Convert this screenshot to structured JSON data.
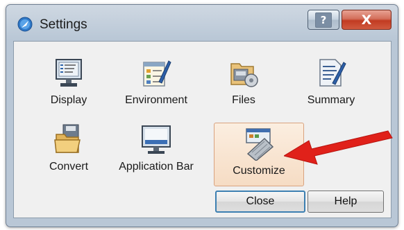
{
  "window": {
    "title": "Settings",
    "help_button_glyph": "?",
    "close_button_glyph": "X"
  },
  "tiles": [
    {
      "label": "Display",
      "icon": "display-icon"
    },
    {
      "label": "Environment",
      "icon": "environment-icon"
    },
    {
      "label": "Files",
      "icon": "files-icon"
    },
    {
      "label": "Summary",
      "icon": "summary-icon"
    },
    {
      "label": "Convert",
      "icon": "convert-icon"
    },
    {
      "label": "Application Bar",
      "icon": "application-bar-icon"
    },
    {
      "label": "Customize",
      "icon": "customize-icon",
      "selected": true
    }
  ],
  "buttons": {
    "close_label": "Close",
    "help_label": "Help"
  },
  "colors": {
    "selection_fill": "#f6dcc4",
    "annotation_arrow": "#e0211a",
    "close_button": "#c23b22"
  }
}
